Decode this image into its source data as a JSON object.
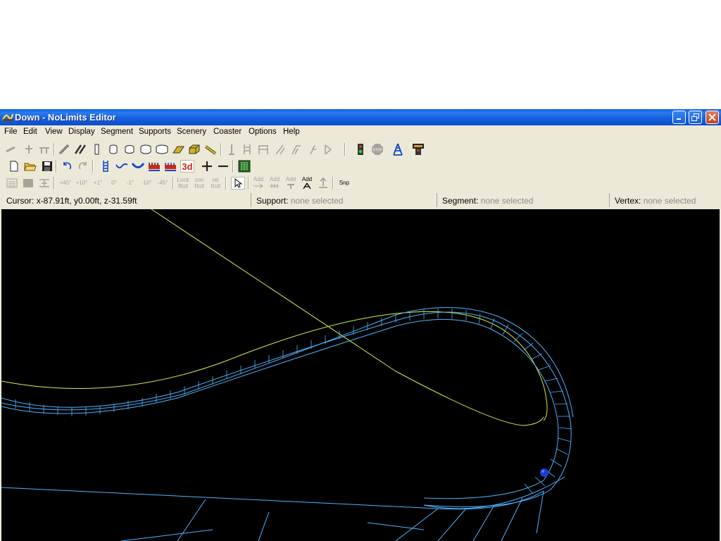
{
  "window": {
    "title": "Down - NoLimits Editor"
  },
  "menu": [
    "File",
    "Edit",
    "View",
    "Display",
    "Segment",
    "Supports",
    "Scenery",
    "Coaster",
    "Options",
    "Help"
  ],
  "toolbar3": {
    "rotate_labels": [
      "+45°",
      "+10°",
      "+1°",
      "0°",
      "-1°",
      "-10°",
      "-45°"
    ],
    "lock_roll": [
      "Lock",
      "Roll"
    ],
    "con_roll": [
      "con",
      "Roll"
    ],
    "rel_roll": [
      "rel",
      "Roll"
    ],
    "add_label": "Add",
    "snap_label": "Snp"
  },
  "toolbar2": {
    "three_d_label": "3d"
  },
  "status": {
    "cursor_label": "Cursor:",
    "cursor_value": "x-87.91ft, y0.00ft, z-31.59ft",
    "support_label": "Support:",
    "support_value": "none selected",
    "segment_label": "Segment:",
    "segment_value": "none selected",
    "vertex_label": "Vertex:",
    "vertex_value": "none selected"
  },
  "colors": {
    "viewport_bg": "#000000",
    "track_wire": "#4fb4ff",
    "spline": "#d4f04a",
    "vertex_marker": "#1a3cd8"
  }
}
